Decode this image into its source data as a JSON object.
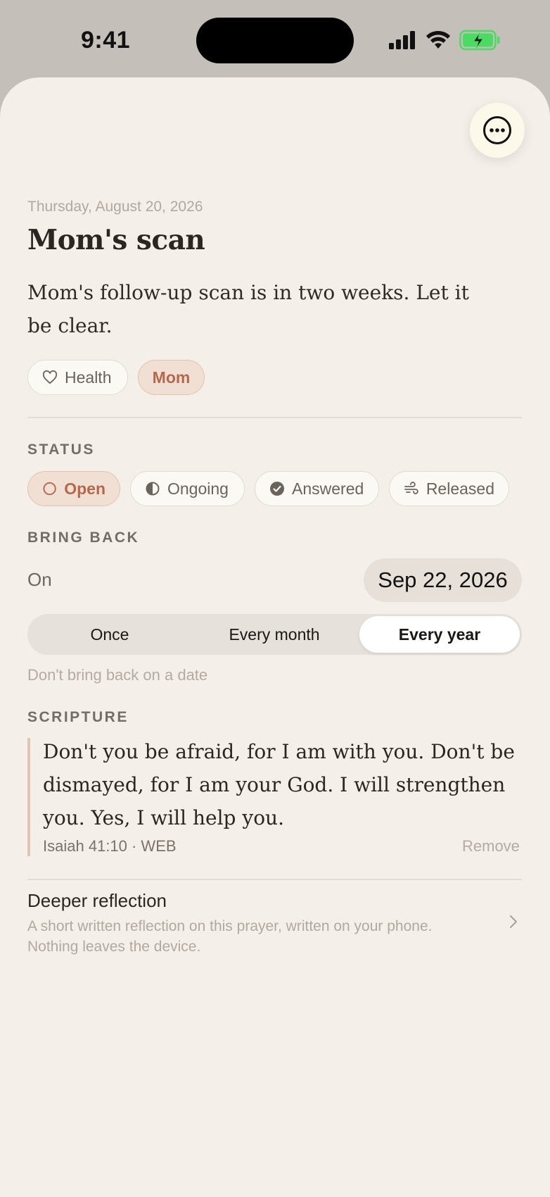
{
  "status_bar": {
    "time": "9:41"
  },
  "header": {
    "more_icon": "ellipsis-circle-icon"
  },
  "prayer": {
    "date": "Thursday, August 20, 2026",
    "title": "Mom's scan",
    "body": "Mom's follow-up scan is in two weeks. Let it be clear.",
    "tags": [
      {
        "label": "Health",
        "icon": "heart-icon",
        "active": false
      },
      {
        "label": "Mom",
        "active": true
      }
    ]
  },
  "status": {
    "label": "STATUS",
    "options": [
      {
        "label": "Open",
        "icon": "circle-icon",
        "active": true
      },
      {
        "label": "Ongoing",
        "icon": "half-circle-icon",
        "active": false
      },
      {
        "label": "Answered",
        "icon": "check-circle-icon",
        "active": false
      },
      {
        "label": "Released",
        "icon": "wind-icon",
        "active": false
      }
    ]
  },
  "bring_back": {
    "label": "BRING BACK",
    "on_label": "On",
    "date": "Sep 22, 2026",
    "frequency": [
      "Once",
      "Every month",
      "Every year"
    ],
    "selected_frequency": "Every year",
    "clear_link": "Don't bring back on a date"
  },
  "scripture": {
    "label": "SCRIPTURE",
    "text": "Don't you be afraid, for I am with you. Don't be dismayed, for I am your God. I will strengthen you. Yes, I will help you.",
    "reference": "Isaiah 41:10 · WEB",
    "remove_label": "Remove"
  },
  "reflection": {
    "title": "Deeper reflection",
    "subtitle": "A short written reflection on this prayer, written on your phone. Nothing leaves the device."
  },
  "colors": {
    "background": "#f4f0e9",
    "accent": "#b4694d",
    "accent_bg": "#f1dfd4",
    "battery": "#4cd964"
  }
}
